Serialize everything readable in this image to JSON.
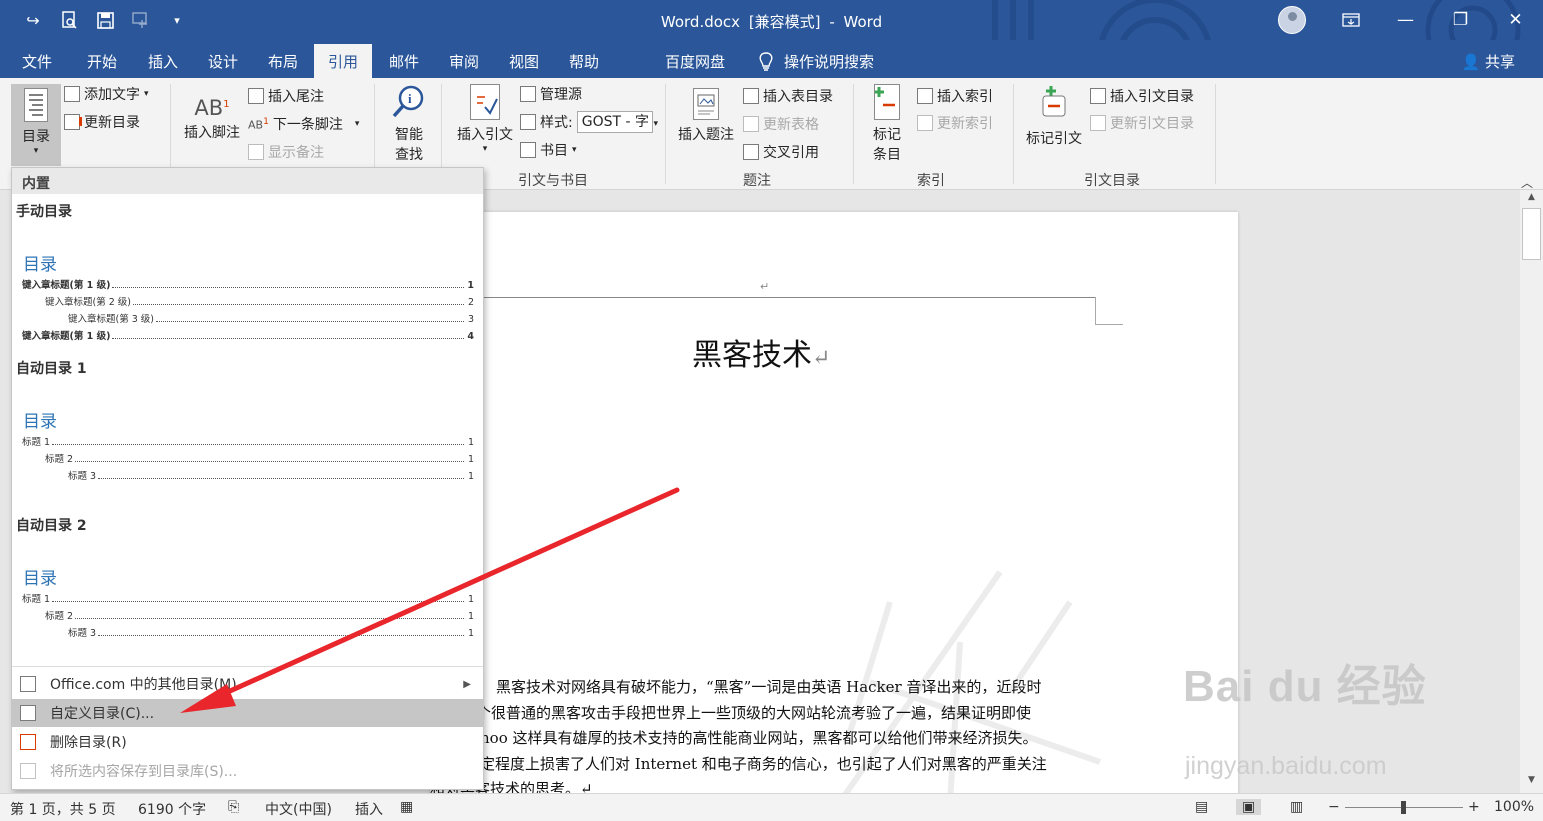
{
  "titlebar": {
    "doc_name": "Word.docx",
    "mode": "[兼容模式]",
    "separator": "-",
    "app": "Word"
  },
  "tabs": [
    "文件",
    "开始",
    "插入",
    "设计",
    "布局",
    "引用",
    "邮件",
    "审阅",
    "视图",
    "帮助",
    "百度网盘"
  ],
  "active_tab": "引用",
  "tell_me": "操作说明搜索",
  "share": "共享",
  "ribbon": {
    "toc_button": "目录",
    "add_text": "添加文字",
    "update_toc": "更新目录",
    "insert_footnote": "插入脚注",
    "insert_endnote": "插入尾注",
    "next_footnote": "下一条脚注",
    "show_notes": "显示备注",
    "smart_lookup_1": "智能",
    "smart_lookup_2": "查找",
    "insert_citation": "插入引文",
    "manage_sources": "管理源",
    "style_label": "样式:",
    "style_value": "GOST - 字",
    "bibliography": "书目",
    "group_citations": "引文与书目",
    "insert_caption": "插入题注",
    "insert_table_of_figures": "插入表目录",
    "update_table": "更新表格",
    "cross_reference": "交叉引用",
    "group_captions": "题注",
    "mark_entry_1": "标记",
    "mark_entry_2": "条目",
    "insert_index": "插入索引",
    "update_index": "更新索引",
    "group_index": "索引",
    "mark_citation": "标记引文",
    "insert_toa": "插入引文目录",
    "update_toa": "更新引文目录",
    "group_toa": "引文目录",
    "ab_label": "AB"
  },
  "dropdown": {
    "section_header": "内置",
    "manual": {
      "name": "手动目录",
      "heading": "目录",
      "lines": [
        {
          "label": "键入章标题(第 1 级)",
          "page": "1",
          "level": 1
        },
        {
          "label": "键入章标题(第 2 级)",
          "page": "2",
          "level": 2
        },
        {
          "label": "键入章标题(第 3 级)",
          "page": "3",
          "level": 3
        },
        {
          "label": "键入章标题(第 1 级)",
          "page": "4",
          "level": 1
        }
      ]
    },
    "auto1": {
      "name": "自动目录 1",
      "heading": "目录",
      "lines": [
        {
          "label": "标题 1",
          "page": "1",
          "level": 1
        },
        {
          "label": "标题 2",
          "page": "1",
          "level": 2
        },
        {
          "label": "标题 3",
          "page": "1",
          "level": 3
        }
      ]
    },
    "auto2": {
      "name": "自动目录 2",
      "heading": "目录",
      "lines": [
        {
          "label": "标题 1",
          "page": "1",
          "level": 1
        },
        {
          "label": "标题 2",
          "page": "1",
          "level": 2
        },
        {
          "label": "标题 3",
          "page": "1",
          "level": 3
        }
      ]
    },
    "menu": {
      "more_office": "Office.com 中的其他目录(M)",
      "custom_toc": "自定义目录(C)...",
      "remove_toc": "删除目录(R)",
      "save_selection": "将所选内容保存到目录库(S)..."
    }
  },
  "document": {
    "title": "黑客技术",
    "return_mark": "↵",
    "lines": [
      "黑客技术对网络具有破坏能力，“黑客”一词是由英语 Hacker 音译出来的，近段时",
      "个很普通的黑客攻击手段把世界上一些顶级的大网站轮流考验了一遍，结果证明即使",
      "hoo 这样具有雄厚的技术支持的高性能商业网站，黑客都可以给他们带来经济损失。",
      "定程度上损害了人们对 Internet 和电子商务的信心，也引起了人们对黑客的严重关注",
      "和对黑客技术的思考。↵"
    ]
  },
  "statusbar": {
    "page": "第 1 页，共 5 页",
    "words": "6190 个字",
    "language": "中文(中国)",
    "mode": "插入",
    "zoom_minus": "−",
    "zoom_plus": "+",
    "zoom": "100%"
  },
  "watermark": {
    "brand": "Bai du 经验",
    "url": "jingyan.baidu.com"
  },
  "colors": {
    "word_blue": "#2b579a",
    "ribbon_bg": "#f3f3f3",
    "toc_heading": "#2e74b5",
    "arrow": "#e8262b"
  }
}
